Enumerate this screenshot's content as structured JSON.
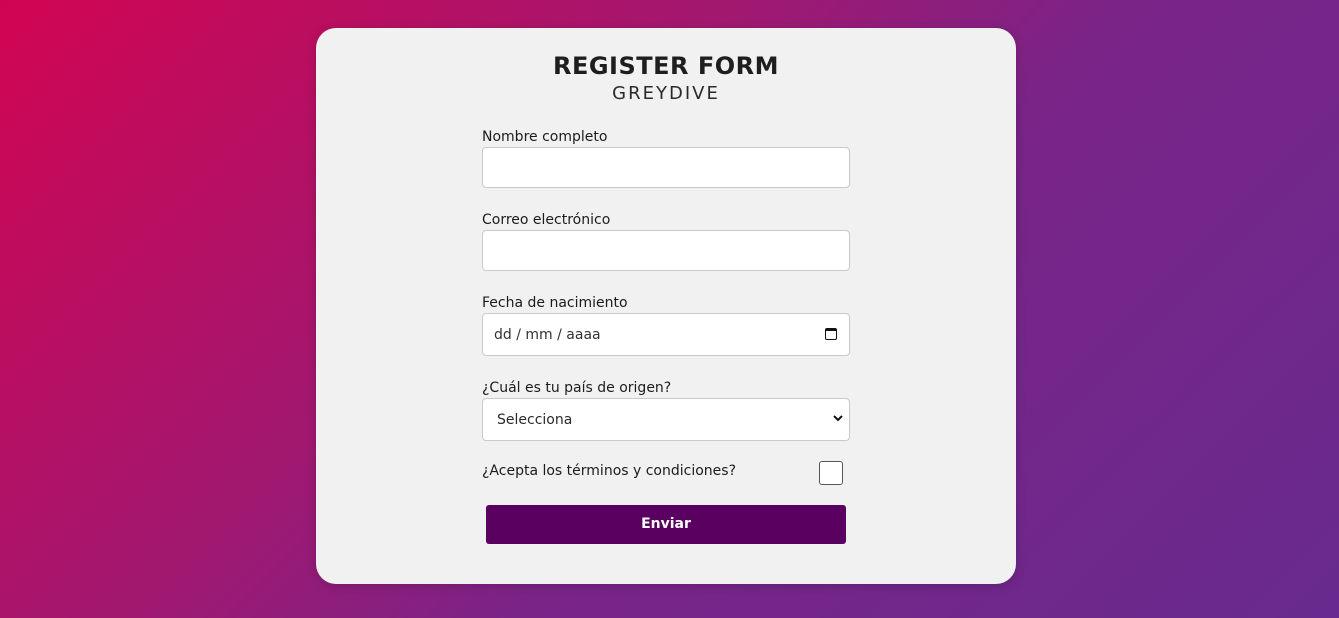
{
  "form": {
    "title": "REGISTER FORM",
    "subtitle": "GREYDIVE",
    "fields": [
      {
        "label": "Nombre completo",
        "value": "",
        "type": "text"
      },
      {
        "label": "Correo electrónico",
        "value": "",
        "type": "email"
      },
      {
        "label": "Fecha de nacimiento",
        "placeholder": "dd / mm / aaaa",
        "type": "date",
        "icon": "calendar-icon"
      },
      {
        "label": "¿Cuál es tu país de origen?",
        "selected": "Selecciona",
        "type": "select",
        "icon": "chevron-down-icon"
      }
    ],
    "terms": {
      "label": "¿Acepta los términos y condiciones?",
      "checked": false
    },
    "submit_label": "Enviar"
  },
  "colors": {
    "gradient_start": "#d10552",
    "gradient_end": "#682a8e",
    "card_background": "#f1f1f1",
    "button_background": "#5a0061",
    "button_text": "#ffffff"
  }
}
